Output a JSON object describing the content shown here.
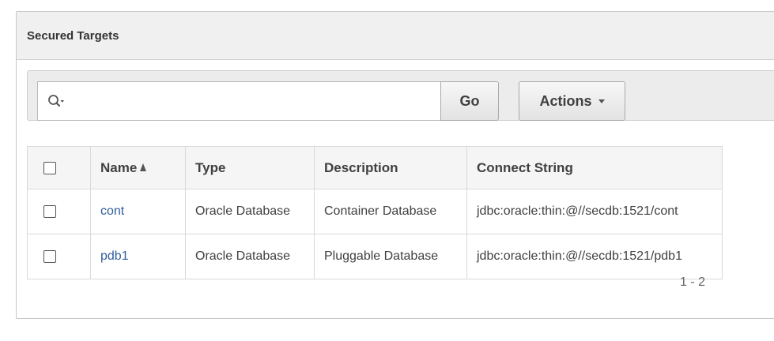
{
  "region": {
    "title": "Secured Targets"
  },
  "toolbar": {
    "search": {
      "value": "",
      "placeholder": ""
    },
    "go_label": "Go",
    "actions_label": "Actions",
    "icons": {
      "search": "search-icon",
      "caret": "caret-down-icon"
    }
  },
  "table": {
    "columns": [
      "Name",
      "Type",
      "Description",
      "Connect String"
    ],
    "sort": {
      "column": "Name",
      "direction": "ascending"
    },
    "rows": [
      {
        "name": "cont",
        "type": "Oracle Database",
        "description": "Container Database",
        "connect_string": "jdbc:oracle:thin:@//secdb:1521/cont",
        "checked": false
      },
      {
        "name": "pdb1",
        "type": "Oracle Database",
        "description": "Pluggable Database",
        "connect_string": "jdbc:oracle:thin:@//secdb:1521/pdb1",
        "checked": false
      }
    ]
  },
  "pagination": {
    "label": "1 - 2"
  },
  "colors": {
    "link": "#2f5e9c",
    "header_bg": "#f0f0f0",
    "toolbar_bg": "#ececec"
  }
}
